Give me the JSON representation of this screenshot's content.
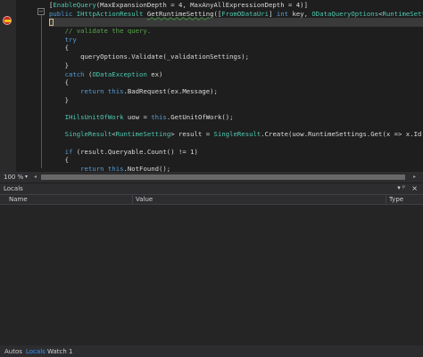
{
  "editor": {
    "lines": [
      [
        {
          "t": "[",
          "c": ""
        },
        {
          "t": "EnableQuery",
          "c": "ty"
        },
        {
          "t": "(MaxExpansionDepth = 4, MaxAnyAllExpressionDepth = 4)]",
          "c": ""
        }
      ],
      [
        {
          "t": "public ",
          "c": "kw"
        },
        {
          "t": "IHttpActionResult",
          "c": "ty"
        },
        {
          "t": " ",
          "c": ""
        },
        {
          "t": "GetRuntimeSetting",
          "c": "sq"
        },
        {
          "t": "([",
          "c": ""
        },
        {
          "t": "FromODataUri",
          "c": "ty"
        },
        {
          "t": "] ",
          "c": ""
        },
        {
          "t": "int",
          "c": "kw"
        },
        {
          "t": " key, ",
          "c": ""
        },
        {
          "t": "ODataQueryOptions",
          "c": "ty"
        },
        {
          "t": "<",
          "c": ""
        },
        {
          "t": "RuntimeSetting",
          "c": "ty"
        },
        {
          "t": "> queryOpt",
          "c": ""
        }
      ],
      [],
      [
        {
          "t": "    // validate the query.",
          "c": "cm"
        }
      ],
      [
        {
          "t": "    try",
          "c": "kw"
        }
      ],
      [
        {
          "t": "    {",
          "c": ""
        }
      ],
      [
        {
          "t": "        queryOptions.Validate(_validationSettings);",
          "c": ""
        }
      ],
      [
        {
          "t": "    }",
          "c": ""
        }
      ],
      [
        {
          "t": "    catch",
          "c": "kw"
        },
        {
          "t": " (",
          "c": ""
        },
        {
          "t": "ODataException",
          "c": "ty"
        },
        {
          "t": " ex)",
          "c": ""
        }
      ],
      [
        {
          "t": "    {",
          "c": ""
        }
      ],
      [
        {
          "t": "        ",
          "c": ""
        },
        {
          "t": "return this",
          "c": "kw"
        },
        {
          "t": ".BadRequest(ex.Message);",
          "c": ""
        }
      ],
      [
        {
          "t": "    }",
          "c": ""
        }
      ],
      [],
      [
        {
          "t": "    ",
          "c": ""
        },
        {
          "t": "IHilsUnitOfWork",
          "c": "ty"
        },
        {
          "t": " uow = ",
          "c": ""
        },
        {
          "t": "this",
          "c": "kw"
        },
        {
          "t": ".GetUnitOfWork();",
          "c": ""
        }
      ],
      [],
      [
        {
          "t": "    ",
          "c": ""
        },
        {
          "t": "SingleResult",
          "c": "ty"
        },
        {
          "t": "<",
          "c": ""
        },
        {
          "t": "RuntimeSetting",
          "c": "ty"
        },
        {
          "t": "> result = ",
          "c": ""
        },
        {
          "t": "SingleResult",
          "c": "ty"
        },
        {
          "t": ".Create(uow.RuntimeSettings.Get(x => x.Id == key));",
          "c": ""
        }
      ],
      [],
      [
        {
          "t": "    ",
          "c": ""
        },
        {
          "t": "if",
          "c": "kw"
        },
        {
          "t": " (result.Queryable.Count() != 1)",
          "c": ""
        }
      ],
      [
        {
          "t": "    {",
          "c": ""
        }
      ],
      [
        {
          "t": "        ",
          "c": ""
        },
        {
          "t": "return this",
          "c": "kw"
        },
        {
          "t": ".NotFound();",
          "c": ""
        }
      ],
      [
        {
          "t": "    }",
          "c": ""
        }
      ]
    ]
  },
  "statusbar": {
    "zoom": "100 %",
    "zoom_arrow": "▾",
    "scroll_left": "◂",
    "scroll_right": "▸"
  },
  "locals": {
    "title": "Locals",
    "pin": "▾ ᵖ",
    "close": "×",
    "columns": {
      "name": "Name",
      "value": "Value",
      "type": "Type"
    }
  },
  "tabs": {
    "autos": "Autos",
    "locals": "Locals",
    "watch": "Watch 1"
  },
  "icons": {
    "breakpoint": "breakpoint-icon",
    "fold": "collapse-icon"
  },
  "colors": {
    "keyword": "#569cd6",
    "type": "#4ec9b0",
    "comment": "#57a64a",
    "active_tab": "#3794ff"
  }
}
